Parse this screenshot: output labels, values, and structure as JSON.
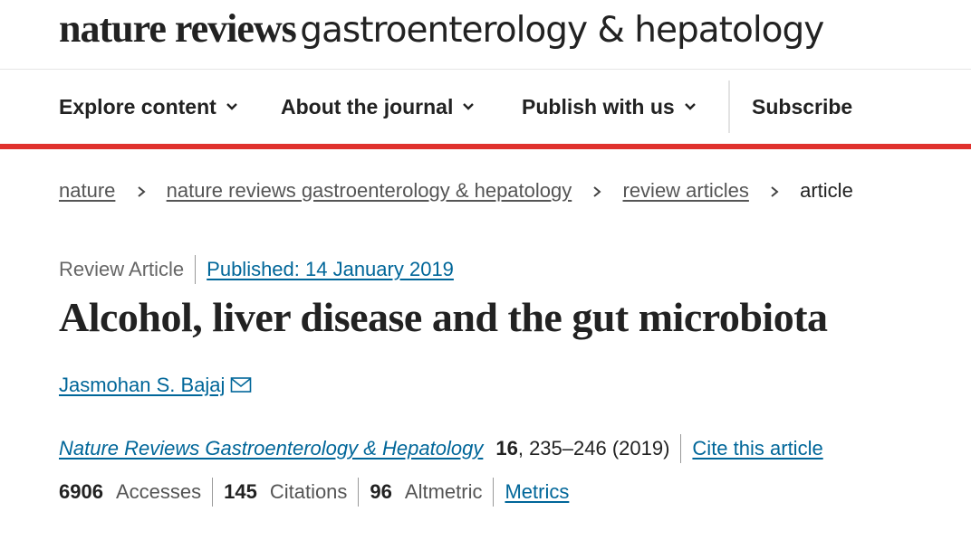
{
  "masthead": {
    "brand_bold": "nature reviews",
    "brand_light": "gastroenterology & hepatology"
  },
  "nav": {
    "items": [
      {
        "label": "Explore content"
      },
      {
        "label": "About the journal"
      },
      {
        "label": "Publish with us"
      }
    ],
    "subscribe_label": "Subscribe"
  },
  "breadcrumb": {
    "items": [
      "nature",
      "nature reviews gastroenterology & hepatology",
      "review articles"
    ],
    "current": "article"
  },
  "article": {
    "type": "Review Article",
    "published": "Published: 14 January 2019",
    "title": "Alcohol, liver disease and the gut microbiota",
    "author": "Jasmohan S. Bajaj",
    "journal": "Nature Reviews Gastroenterology & Hepatology",
    "volume": "16",
    "pages": ", 235–246 (2019)",
    "cite_label": "Cite this article"
  },
  "metrics": {
    "accesses": "6906",
    "accesses_label": "Accesses",
    "citations": "145",
    "citations_label": "Citations",
    "altmetric": "96",
    "altmetric_label": "Altmetric",
    "metrics_link": "Metrics"
  },
  "colors": {
    "accent_red": "#e0312d",
    "link_blue": "#006699"
  }
}
